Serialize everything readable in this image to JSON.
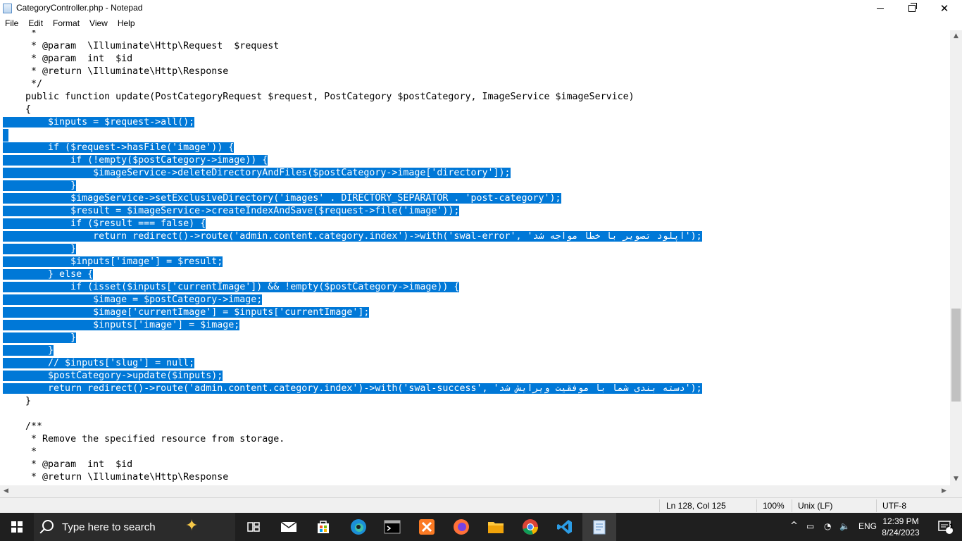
{
  "window": {
    "title": "CategoryController.php - Notepad"
  },
  "menu": [
    "File",
    "Edit",
    "Format",
    "View",
    "Help"
  ],
  "editor": {
    "lines": [
      {
        "text": "     *",
        "sel": false
      },
      {
        "text": "     * @param  \\Illuminate\\Http\\Request  $request",
        "sel": false
      },
      {
        "text": "     * @param  int  $id",
        "sel": false
      },
      {
        "text": "     * @return \\Illuminate\\Http\\Response",
        "sel": false
      },
      {
        "text": "     */",
        "sel": false
      },
      {
        "text": "    public function update(PostCategoryRequest $request, PostCategory $postCategory, ImageService $imageService)",
        "sel": false
      },
      {
        "text": "    {",
        "sel": false
      },
      {
        "text": "        $inputs = $request->all();",
        "sel": true
      },
      {
        "text": "",
        "sel": true
      },
      {
        "text": "        if ($request->hasFile('image')) {",
        "sel": true
      },
      {
        "text": "            if (!empty($postCategory->image)) {",
        "sel": true
      },
      {
        "text": "                $imageService->deleteDirectoryAndFiles($postCategory->image['directory']);",
        "sel": true
      },
      {
        "text": "            }",
        "sel": true
      },
      {
        "text": "            $imageService->setExclusiveDirectory('images' . DIRECTORY_SEPARATOR . 'post-category');",
        "sel": true
      },
      {
        "text": "            $result = $imageService->createIndexAndSave($request->file('image'));",
        "sel": true
      },
      {
        "text": "            if ($result === false) {",
        "sel": true
      },
      {
        "text": "                return redirect()->route('admin.content.category.index')->with('swal-error', 'آپلود تصویر با خطا مواجه شد');",
        "sel": true
      },
      {
        "text": "            }",
        "sel": true
      },
      {
        "text": "            $inputs['image'] = $result;",
        "sel": true
      },
      {
        "text": "        } else {",
        "sel": true
      },
      {
        "text": "            if (isset($inputs['currentImage']) && !empty($postCategory->image)) {",
        "sel": true
      },
      {
        "text": "                $image = $postCategory->image;",
        "sel": true
      },
      {
        "text": "                $image['currentImage'] = $inputs['currentImage'];",
        "sel": true
      },
      {
        "text": "                $inputs['image'] = $image;",
        "sel": true
      },
      {
        "text": "            }",
        "sel": true
      },
      {
        "text": "        }",
        "sel": true
      },
      {
        "text": "        // $inputs['slug'] = null;",
        "sel": true
      },
      {
        "text": "        $postCategory->update($inputs);",
        "sel": true
      },
      {
        "text": "        return redirect()->route('admin.content.category.index')->with('swal-success', 'دسته بندی شما با موفقیت ویرایش شد');",
        "sel": true
      },
      {
        "text": "    }",
        "sel": false
      },
      {
        "text": "",
        "sel": false
      },
      {
        "text": "    /**",
        "sel": false
      },
      {
        "text": "     * Remove the specified resource from storage.",
        "sel": false
      },
      {
        "text": "     *",
        "sel": false
      },
      {
        "text": "     * @param  int  $id",
        "sel": false
      },
      {
        "text": "     * @return \\Illuminate\\Http\\Response",
        "sel": false
      }
    ]
  },
  "status": {
    "position": "Ln 128, Col 125",
    "zoom": "100%",
    "line_ending": "Unix (LF)",
    "encoding": "UTF-8"
  },
  "taskbar": {
    "search_placeholder": "Type here to search",
    "language": "ENG",
    "time": "12:39 PM",
    "date": "8/24/2023",
    "notification_count": "1"
  }
}
